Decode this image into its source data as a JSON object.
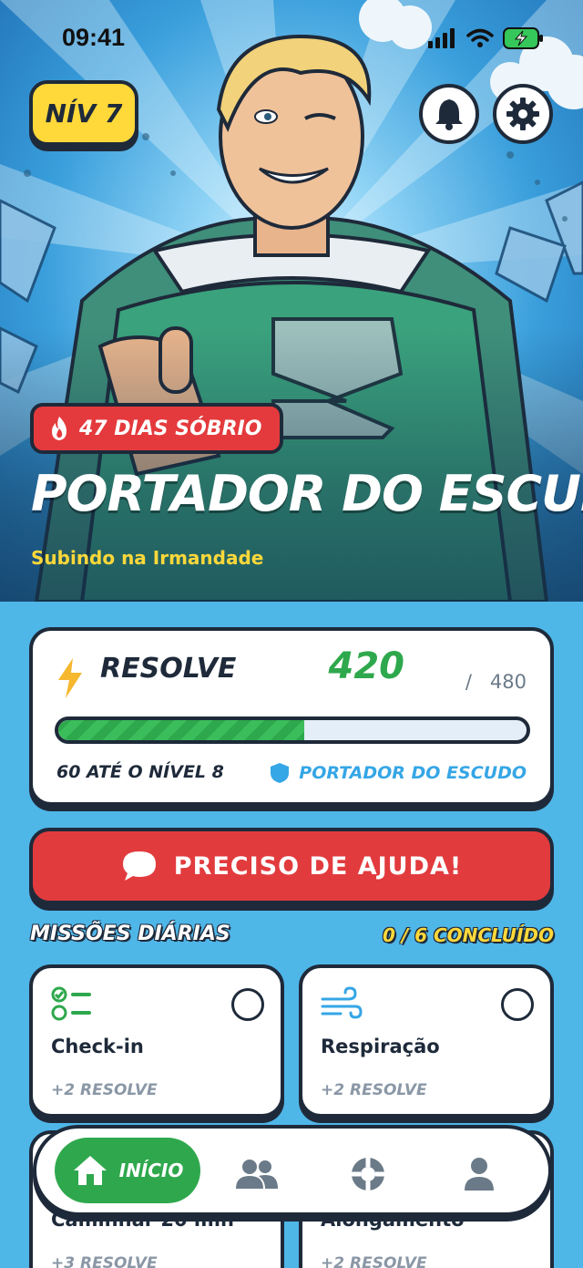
{
  "status_bar": {
    "time": "09:41"
  },
  "header": {
    "level_badge": "NÍV 7",
    "sober_days": "47 DIAS SÓBRIO",
    "title": "PORTADOR DO ESCUDO",
    "subtitle": "Subindo na Irmandade"
  },
  "resolve": {
    "label": "RESOLVE",
    "current": "420",
    "separator": "/",
    "max": "480",
    "progress": 0.525,
    "to_next_level": "60 ATÉ O NÍVEL 8",
    "rank": "PORTADOR DO ESCUDO"
  },
  "help_button": {
    "label": "PRECISO DE AJUDA!"
  },
  "missions": {
    "title": "MISSÕES DIÁRIAS",
    "count": "0 / 6 CONCLUÍDO",
    "items": [
      {
        "name": "Check-in",
        "reward": "+2 RESOLVE",
        "icon": "checklist-icon"
      },
      {
        "name": "Respiração",
        "reward": "+2 RESOLVE",
        "icon": "wind-icon"
      },
      {
        "name": "Caminhar 20 min",
        "reward": "+3 RESOLVE",
        "icon": "walk-icon"
      },
      {
        "name": "Alongamento",
        "reward": "+2 RESOLVE",
        "icon": "stretch-icon"
      }
    ]
  },
  "nav": {
    "home_label": "INÍCIO",
    "items": [
      "home-icon",
      "community-icon",
      "support-icon",
      "profile-icon"
    ]
  },
  "colors": {
    "brand_blue": "#4fb6e8",
    "accent_yellow": "#ffd83a",
    "danger_red": "#e23b3e",
    "success_green": "#2ea84c",
    "ink": "#1e2a3a"
  }
}
